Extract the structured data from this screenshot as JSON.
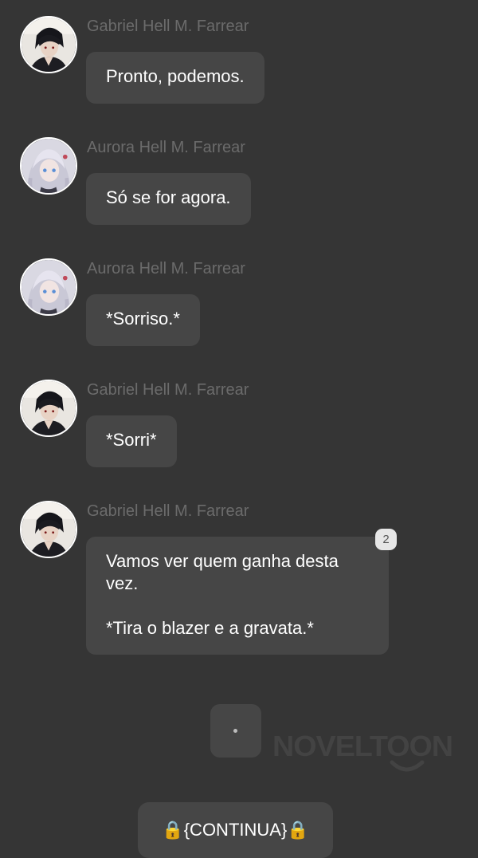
{
  "messages": [
    {
      "sender": "Gabriel Hell M. Farrear",
      "text": "Pronto, podemos.",
      "avatar": "gabriel-avatar"
    },
    {
      "sender": "Aurora Hell M. Farrear",
      "text": "Só se for agora.",
      "avatar": "aurora-avatar"
    },
    {
      "sender": "Aurora Hell M. Farrear",
      "text": "*Sorriso.*",
      "avatar": "aurora-avatar"
    },
    {
      "sender": "Gabriel Hell M. Farrear",
      "text": "*Sorri*",
      "avatar": "gabriel-avatar"
    },
    {
      "sender": "Gabriel Hell M. Farrear",
      "text": "Vamos ver quem ganha desta\nvez.\n\n*Tira o blazer e a gravata.*",
      "avatar": "gabriel-avatar",
      "badge": "2"
    }
  ],
  "watermark": {
    "text": "NOVELTOON"
  },
  "continue_button": {
    "label": "🔒{CONTINUA}🔒"
  },
  "colors": {
    "background": "#353535",
    "bubble": "#464646",
    "sender_name": "#6b6b6b",
    "text": "#ffffff",
    "watermark": "#434343"
  }
}
